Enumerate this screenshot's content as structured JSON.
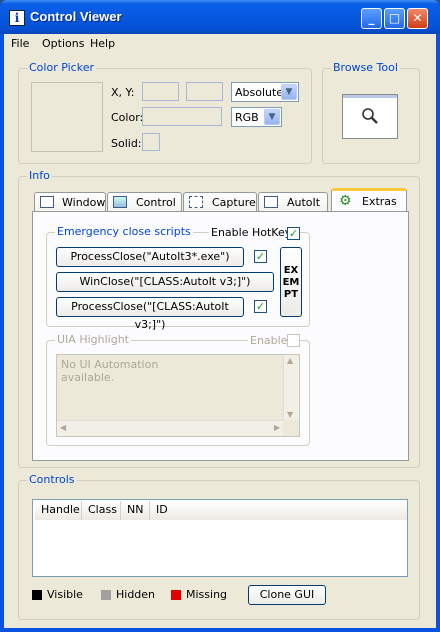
{
  "window": {
    "title": "Control Viewer",
    "icon": "info-icon"
  },
  "title_buttons": {
    "minimize": "_",
    "maximize": "□",
    "close": "✕"
  },
  "menu": [
    "File",
    "Options",
    "Help"
  ],
  "color_picker": {
    "label": "Color Picker",
    "xy_label": "X, Y:",
    "coord_mode": "Absolute",
    "color_label": "Color:",
    "color_mode": "RGB",
    "solid_label": "Solid:"
  },
  "browse_tool": {
    "label": "Browse Tool",
    "icon": "magnifier-icon"
  },
  "info": {
    "label": "Info",
    "tabs": [
      "Window",
      "Control",
      "Capture",
      "AutoIt",
      "Extras"
    ],
    "active_tab": "Extras"
  },
  "extras": {
    "emergency_label": "Emergency close scripts",
    "enable_hotkey": "Enable HotKey",
    "scripts": [
      "ProcessClose(\"AutoIt3*.exe\")",
      "WinClose(\"[CLASS:AutoIt v3;]\")",
      "ProcessClose(\"[CLASS:AutoIt v3;]\")"
    ],
    "exempt_label": "EXEMPT",
    "exempt_lines": [
      "EX",
      "EM",
      "PT"
    ],
    "uia_label": "UIA Highlight",
    "uia_enable": "Enable",
    "uia_text": [
      "No UI Automation",
      "available."
    ]
  },
  "controls": {
    "label": "Controls",
    "columns": [
      "Handle",
      "Class",
      "NN",
      "ID"
    ],
    "legend": [
      {
        "label": "Visible",
        "color": "#000000"
      },
      {
        "label": "Hidden",
        "color": "#a0a0a0"
      },
      {
        "label": "Missing",
        "color": "#e00000"
      }
    ],
    "clone_button": "Clone GUI"
  }
}
